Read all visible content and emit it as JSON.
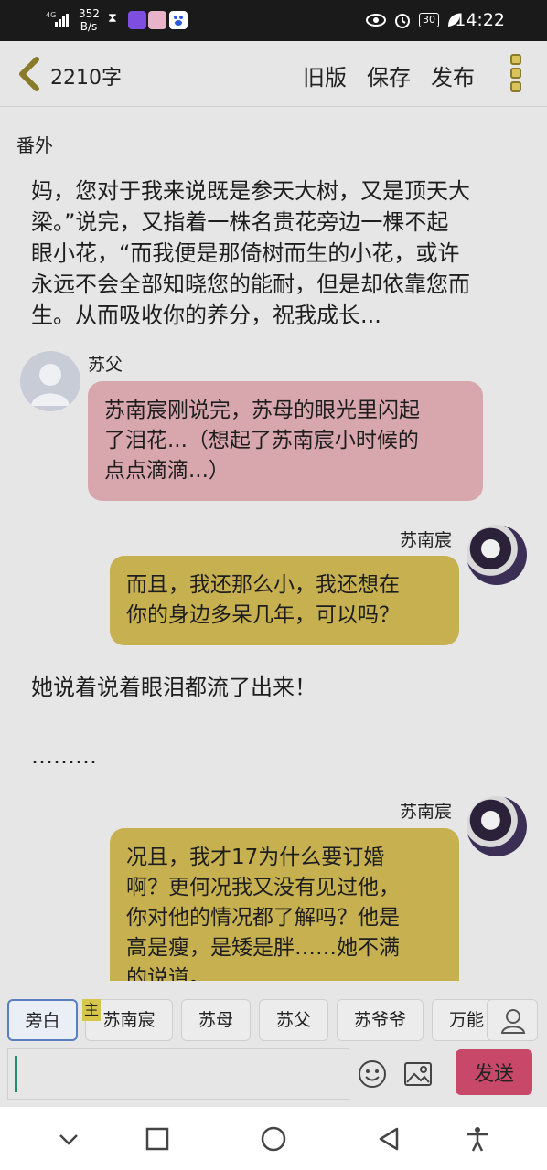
{
  "status_bar": {
    "network": "4G",
    "speed_value": "352",
    "speed_unit": "B/s",
    "battery": "30",
    "time": "14:22",
    "icons": [
      "signal-icon",
      "hourglass-icon",
      "video-app-icon",
      "news-app-icon",
      "baidu-app-icon",
      "eye-icon",
      "alarm-icon",
      "battery-icon",
      "leaf-icon"
    ]
  },
  "header": {
    "back_icon": "chevron-left-icon",
    "word_count": "2210字",
    "actions": [
      "旧版",
      "保存",
      "发布"
    ],
    "more_icon": "more-vertical-icon"
  },
  "content": {
    "chapter_title": "番外",
    "paragraph_1": [
      "妈，您对于我来说既是参天大树，又是顶天大",
      "梁。”说完，又指着一株名贵花旁边一棵不起",
      "眼小花，“而我便是那倚树而生的小花，或许",
      "永远不会全部知晓您的能耐，但是却依靠您而",
      "生。从而吸收你的养分，祝我成长..."
    ],
    "messages": [
      {
        "speaker": "苏父",
        "side": "left",
        "color": "pink",
        "lines": [
          "苏南宸刚说完，苏母的眼光里闪起",
          "了泪花...（想起了苏南宸小时候的",
          "点点滴滴...）"
        ]
      },
      {
        "speaker": "苏南宸",
        "side": "right",
        "color": "gold",
        "lines": [
          "而且，我还那么小，我还想在",
          "你的身边多呆几年，可以吗？"
        ]
      }
    ],
    "paragraph_2": "她说着说着眼泪都流了出来！",
    "paragraph_3": "………",
    "message_3": {
      "speaker": "苏南宸",
      "side": "right",
      "color": "gold",
      "lines": [
        "况且，我才17为什么要订婚",
        "啊？更何况我又没有见过他，",
        "你对他的情况都了解吗？他是",
        "高是瘦，是矮是胖……她不满",
        "的说道。"
      ]
    }
  },
  "role_bar": {
    "roles": [
      "旁白",
      "苏南宸",
      "苏母",
      "苏父",
      "苏爷爷",
      "万能"
    ],
    "active_role": "旁白",
    "master_tag": "主",
    "user_icon": "user-icon"
  },
  "input_bar": {
    "value": "",
    "emoji_icon": "emoji-icon",
    "image_icon": "image-icon",
    "send_label": "发送"
  },
  "nav_bar": {
    "icons": [
      "chevron-down-icon",
      "recent-apps-icon",
      "home-icon",
      "back-icon",
      "accessibility-icon"
    ]
  },
  "colors": {
    "pink_bubble": "#d8a6ad",
    "gold_bubble": "#c7b050",
    "send_button": "#c8486a",
    "active_role_border": "#5a7ec2"
  }
}
